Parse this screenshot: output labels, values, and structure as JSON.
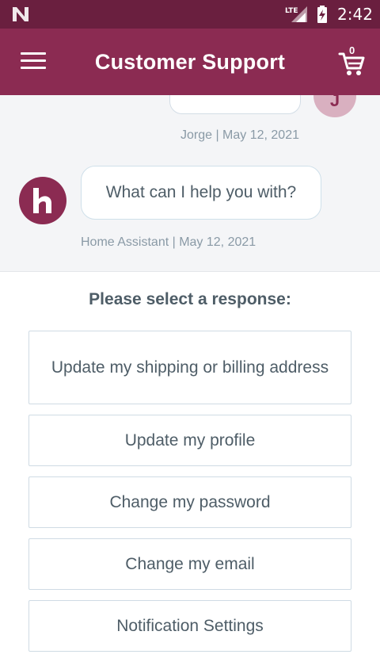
{
  "status_bar": {
    "time": "2:42",
    "network_label": "LTE",
    "icons": [
      "n-logo-icon",
      "lte-signal-icon",
      "battery-charging-icon"
    ]
  },
  "app_bar": {
    "title": "Customer Support",
    "cart_count": "0",
    "icons": [
      "hamburger-menu-icon",
      "cart-icon"
    ]
  },
  "chat": {
    "user_message": {
      "avatar_initial": "J",
      "author": "Jorge",
      "date": "May 12, 2021",
      "meta": "Jorge | May 12, 2021"
    },
    "assistant_message": {
      "text": "What can I help you with?",
      "author": "Home Assistant",
      "date": "May 12, 2021",
      "meta": "Home Assistant | May 12, 2021"
    }
  },
  "responses": {
    "title": "Please select a response:",
    "options": [
      "Update my shipping or billing address",
      "Update my profile",
      "Change my password",
      "Change my email",
      "Notification Settings"
    ]
  },
  "colors": {
    "status_bar": "#6a1f3f",
    "app_bar": "#8b2b52",
    "chat_background": "#f4f5f7",
    "text": "#4e5d67",
    "meta_text": "#8a9aa6"
  }
}
